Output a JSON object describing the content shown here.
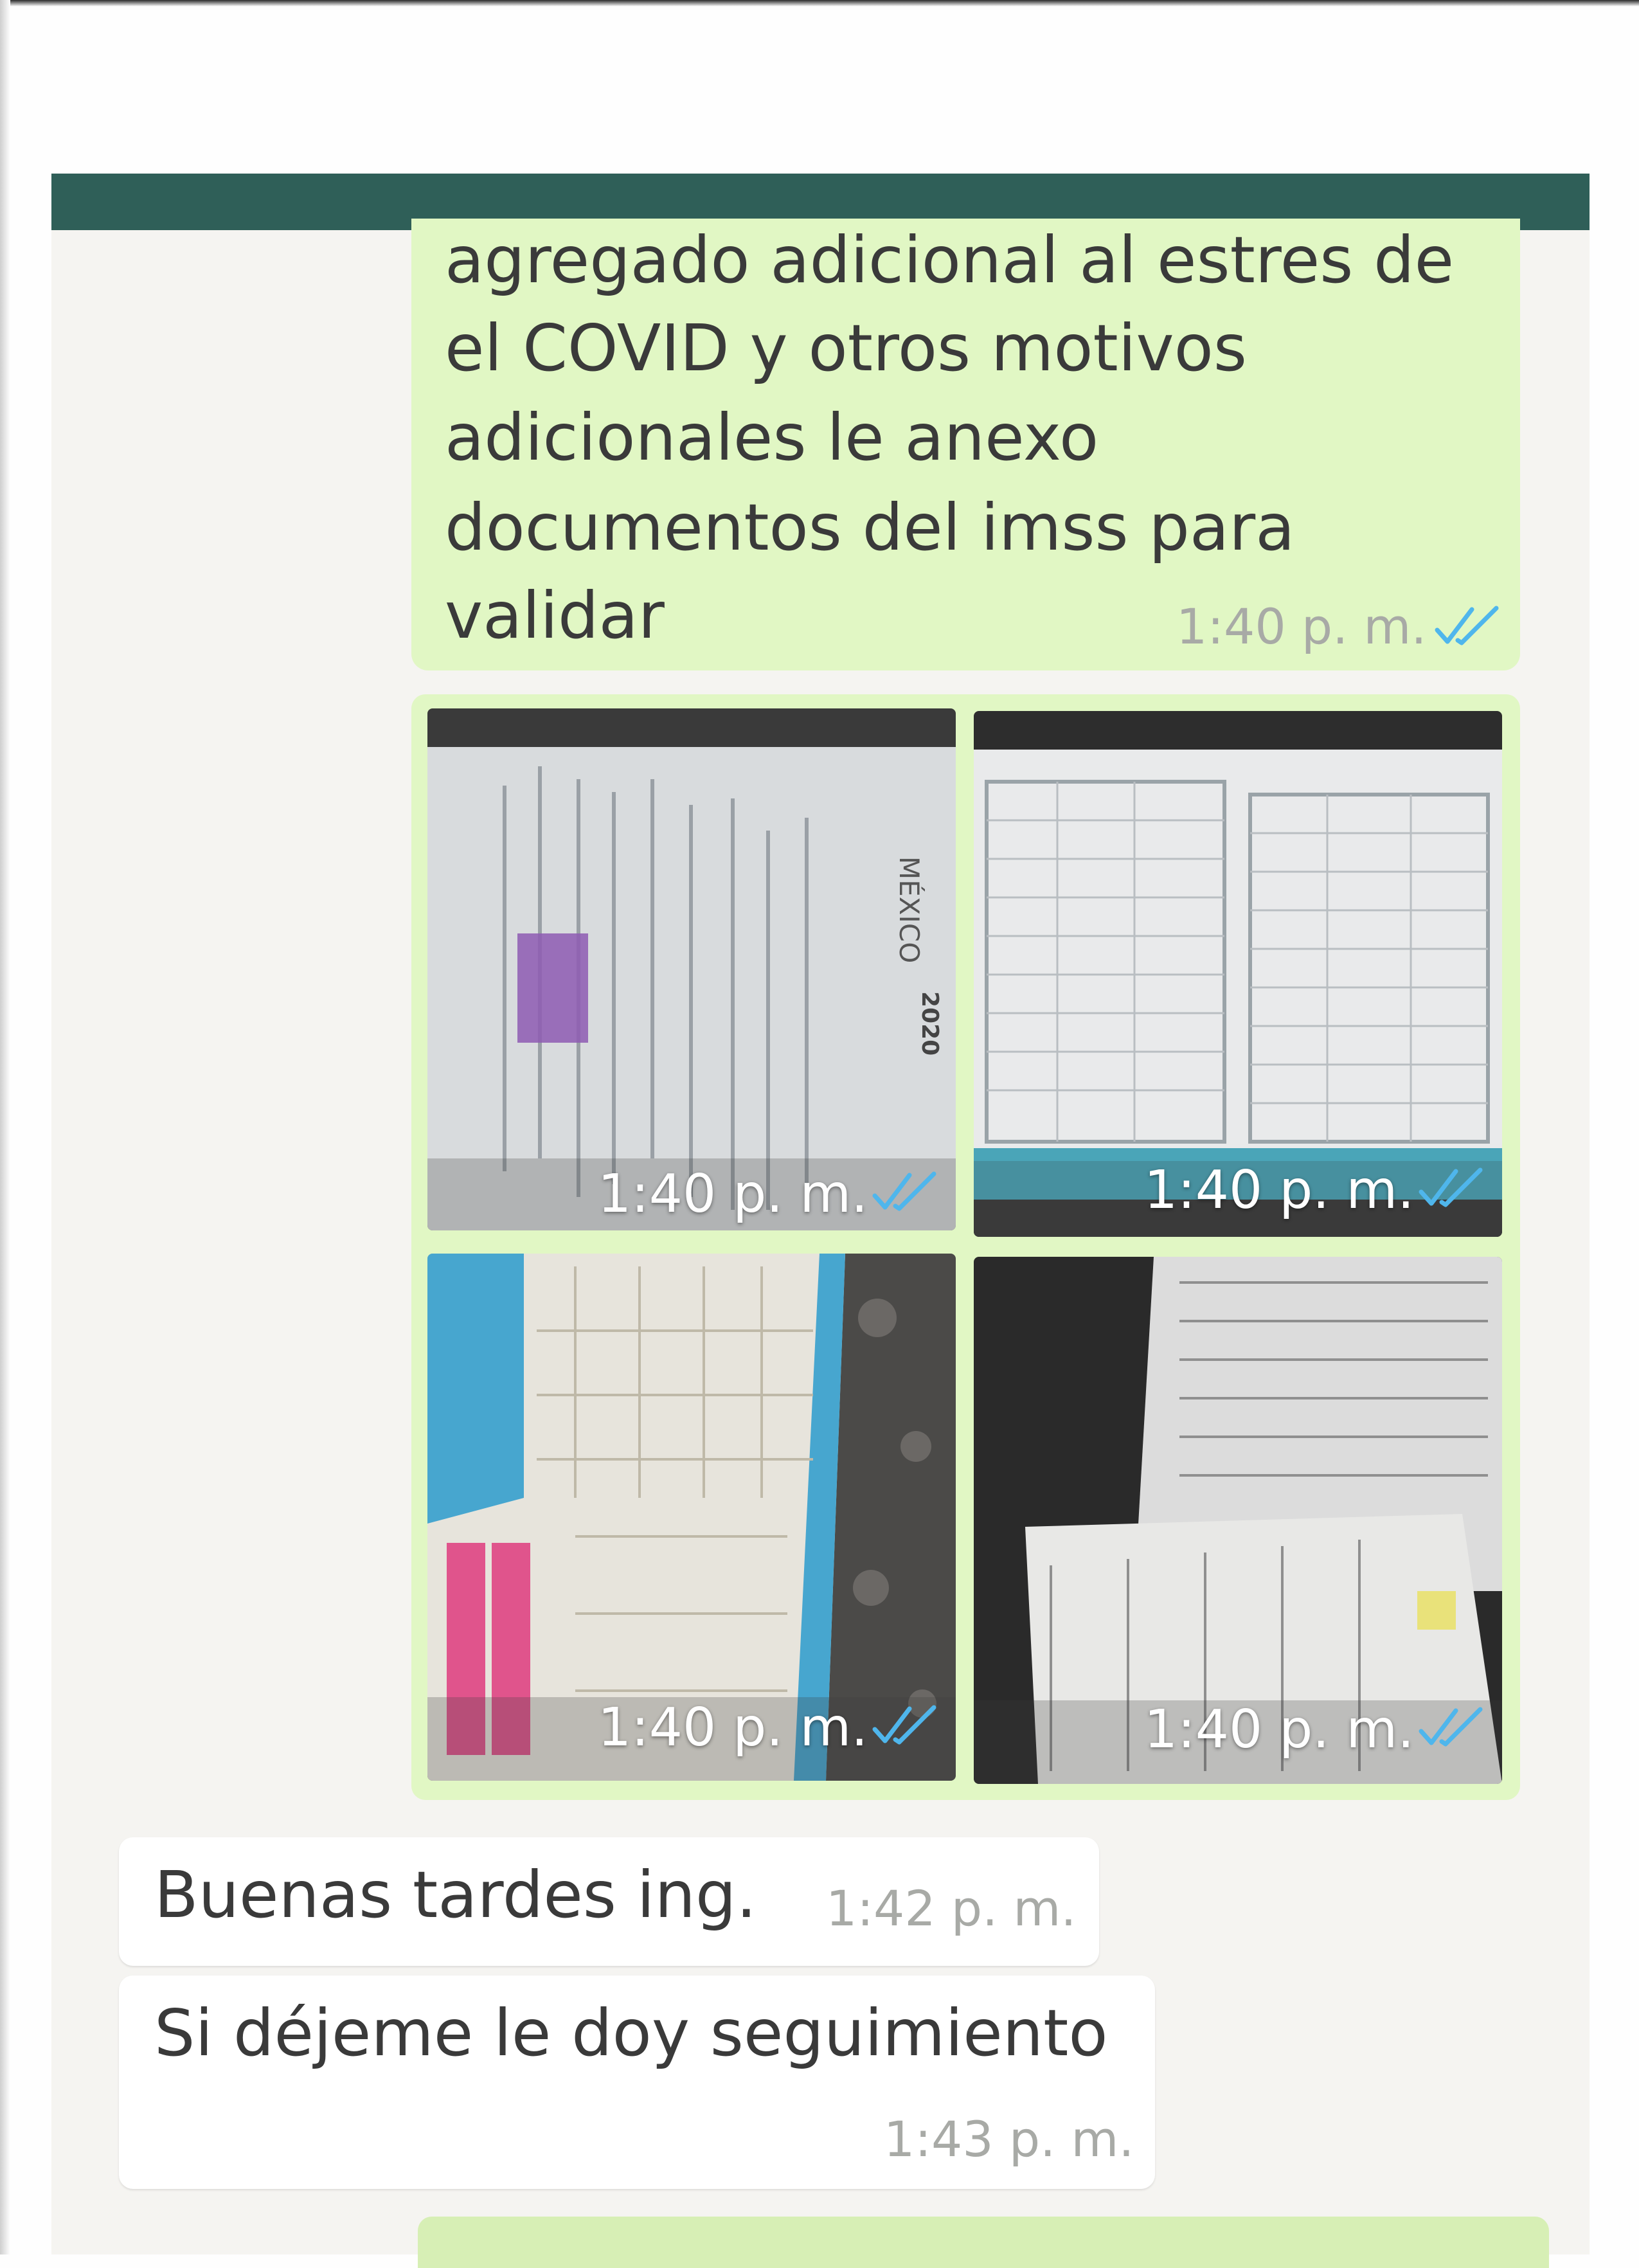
{
  "messages": {
    "outgoing_text": {
      "lines": [
        "agregado adicional al estres de",
        "el COVID y otros motivos",
        "adicionales le anexo",
        "documentos del imss para",
        "validar"
      ],
      "time": "1:40 p. m.",
      "status_icon": "double-check-icon"
    },
    "photo_album": {
      "photos": [
        {
          "time": "1:40 p. m.",
          "status_icon": "double-check-icon",
          "caption_words": [
            "MÉXICO",
            "2020"
          ]
        },
        {
          "time": "1:40 p. m.",
          "status_icon": "double-check-icon"
        },
        {
          "time": "1:40 p. m.",
          "status_icon": "double-check-icon"
        },
        {
          "time": "1:40 p. m.",
          "status_icon": "double-check-icon"
        }
      ]
    },
    "incoming": [
      {
        "text": "Buenas tardes ing.",
        "time": "1:42 p. m."
      },
      {
        "text": "Si déjeme le doy seguimiento",
        "time": "1:43 p. m."
      }
    ]
  },
  "colors": {
    "header": "#2f5f58",
    "outgoing_bubble": "#e1f7c4",
    "incoming_bubble": "#ffffff",
    "chat_background": "#f5f4f1",
    "read_ticks": "#4fb6ec",
    "timestamp": "#a8aaa6"
  }
}
